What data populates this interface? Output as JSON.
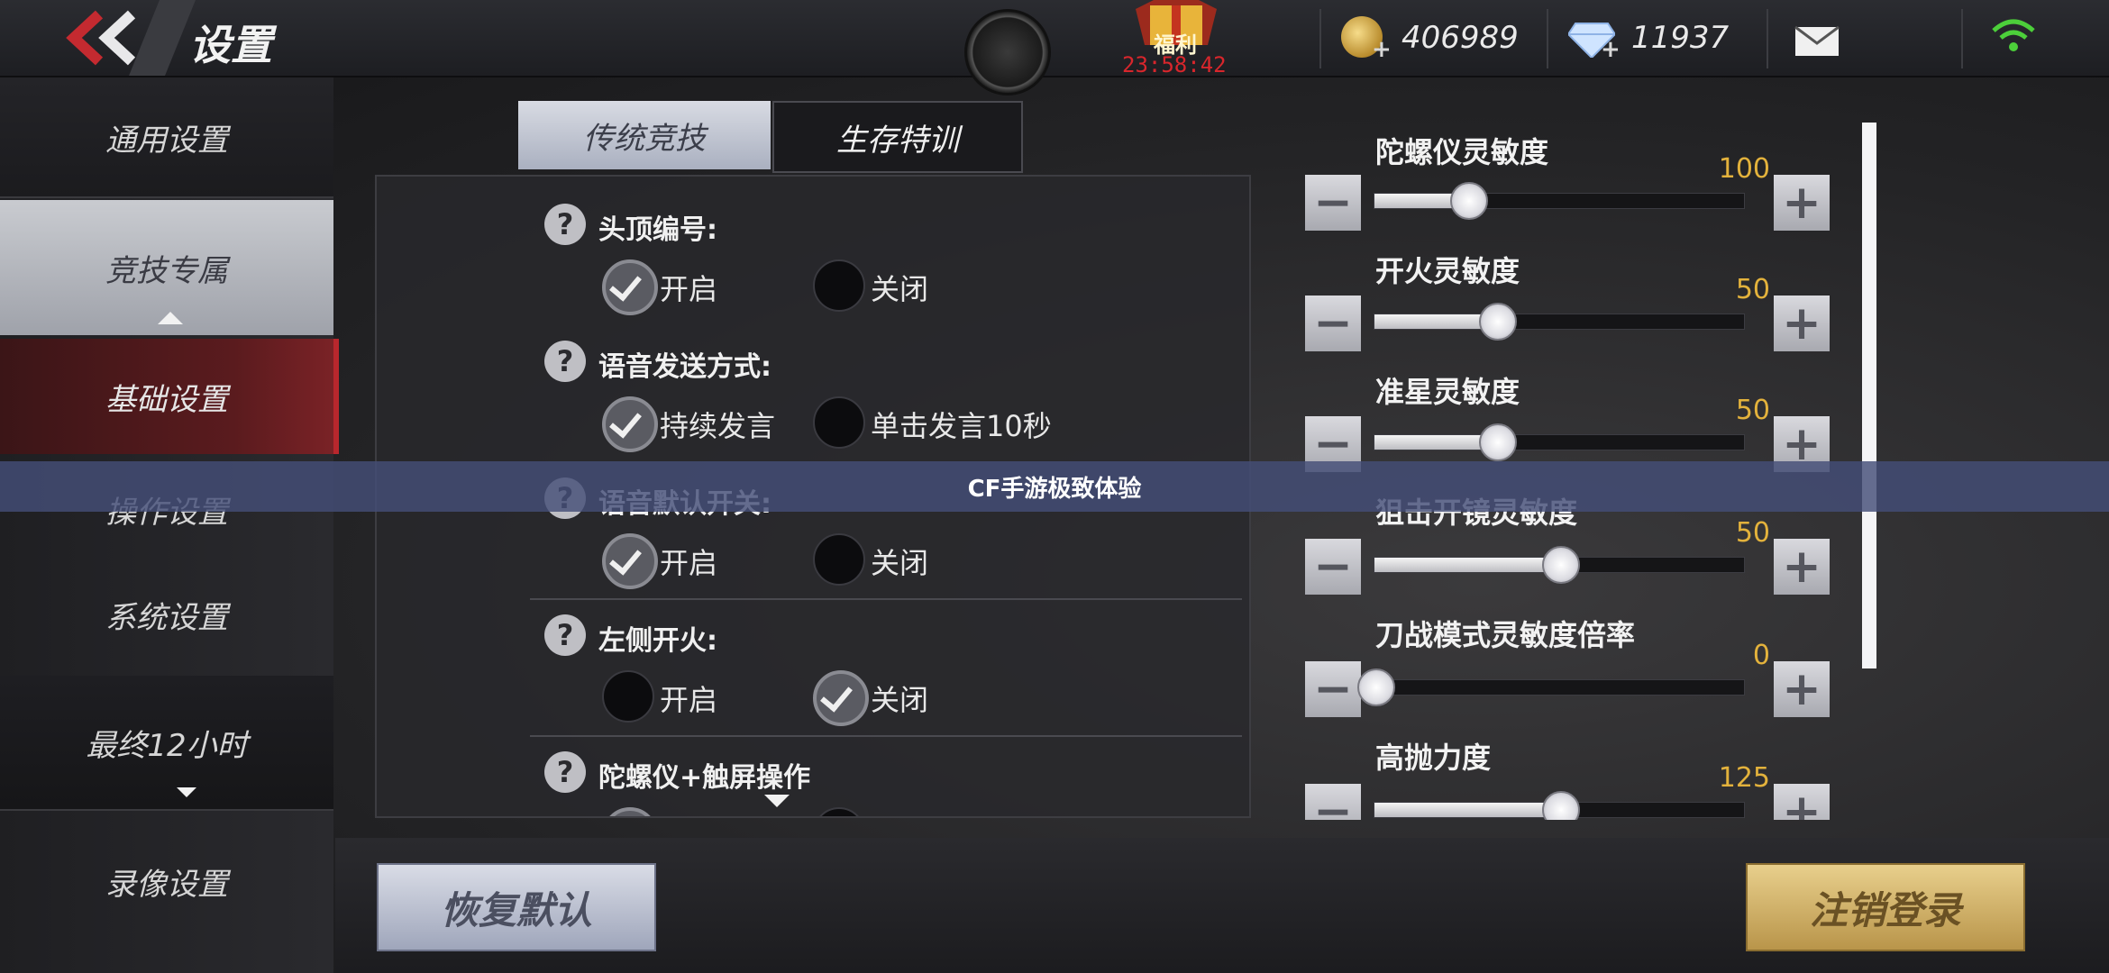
{
  "header": {
    "title": "设置",
    "welfare_label": "福利",
    "timer": "23:58:42",
    "gold": "406989",
    "diamonds": "11937",
    "plus": "+"
  },
  "sidebar": {
    "items": [
      {
        "label": "通用设置"
      },
      {
        "label": "竞技专属"
      },
      {
        "label": "基础设置"
      },
      {
        "label": "操作设置"
      },
      {
        "label": "系统设置"
      },
      {
        "label": "最终12小时"
      },
      {
        "label": "录像设置"
      }
    ]
  },
  "tabs": [
    {
      "label": "传统竞技",
      "active": true
    },
    {
      "label": "生存特训",
      "active": false
    }
  ],
  "options": [
    {
      "title": "头顶编号:",
      "choices": [
        "开启",
        "关闭"
      ],
      "selected": 0
    },
    {
      "title": "语音发送方式:",
      "choices": [
        "持续发言",
        "单击发言10秒"
      ],
      "selected": 0
    },
    {
      "title": "语音默认开关:",
      "choices": [
        "开启",
        "关闭"
      ],
      "selected": 0
    },
    {
      "title": "左侧开火:",
      "choices": [
        "开启",
        "关闭"
      ],
      "selected": 1
    },
    {
      "title": "陀螺仪+触屏操作"
    }
  ],
  "sensitivity": [
    {
      "label": "陀螺仪灵敏度",
      "value": "100",
      "fraction": 0.25
    },
    {
      "label": "开火灵敏度",
      "value": "50",
      "fraction": 0.33
    },
    {
      "label": "准星灵敏度",
      "value": "50",
      "fraction": 0.33
    },
    {
      "label": "狙击开镜灵敏度",
      "value": "50",
      "fraction": 0.5
    },
    {
      "label": "刀战模式灵敏度倍率",
      "value": "0",
      "fraction": 0.0
    },
    {
      "label": "高抛力度",
      "value": "125",
      "fraction": 0.5
    }
  ],
  "buttons": {
    "reset": "恢复默认",
    "logout": "注销登录",
    "minus": "−",
    "plus": "+"
  },
  "banner": "CF手游极致体验",
  "colors": {
    "accent_gold": "#e3b23c",
    "accent_red": "#b8272d",
    "wifi": "#4ccf3a"
  }
}
